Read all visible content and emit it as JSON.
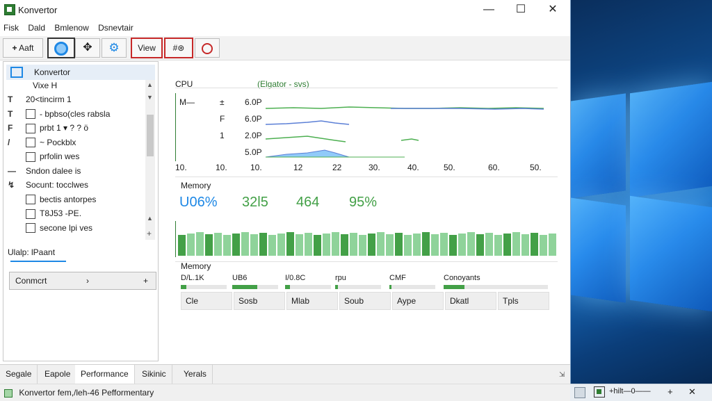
{
  "window": {
    "title": "Konvertor",
    "controls": {
      "minimize": "—",
      "maximize": "☐",
      "close": "✕"
    }
  },
  "menu": [
    "Fisk",
    "Dald",
    "Bmlenow",
    "Dsnevtair"
  ],
  "toolbar": {
    "add_label": "Aaft",
    "view_label": "View",
    "ext_label": "#⊛"
  },
  "tree": {
    "root": "Konvertor",
    "sub": "Vixe H",
    "items": [
      {
        "glyph": "T",
        "box": false,
        "label": "20<tincirm 1"
      },
      {
        "glyph": "T",
        "box": true,
        "label": "- bpbso(cles rabsla"
      },
      {
        "glyph": "F",
        "box": true,
        "label": "prbt 1   ▾   ? ?  ö"
      },
      {
        "glyph": "/",
        "box": true,
        "label": "~ Pockblx"
      },
      {
        "glyph": "",
        "box": true,
        "label": "prfolin wes"
      },
      {
        "glyph": "—",
        "box": false,
        "label": "Sndon dalee is"
      },
      {
        "glyph": "↯",
        "box": false,
        "label": "Socunt: tocclwes"
      },
      {
        "glyph": "",
        "box": true,
        "label": "bectis antorpes"
      },
      {
        "glyph": "",
        "box": true,
        "label": "T8J53 -PE."
      },
      {
        "glyph": "",
        "box": true,
        "label": "secone lpi ves"
      }
    ],
    "footer_label": "Ulalp: lPaant",
    "combo_label": "Conmcrt",
    "combo_arrow": "›",
    "combo_plus": "+"
  },
  "cpu": {
    "title": "CPU",
    "legend": "(Elgator - svs)",
    "rows": [
      {
        "label": "M—",
        "k": "±",
        "v": "6.0P"
      },
      {
        "label": "",
        "k": "F",
        "v": "6.0P"
      },
      {
        "label": "",
        "k": "1",
        "v": "2.0P"
      },
      {
        "label": "",
        "k": "",
        "v": "5.0P"
      }
    ],
    "xticks": [
      "10.",
      "10.",
      "10.",
      "12",
      "22",
      "30.",
      "40.",
      "50.",
      "60.",
      "50."
    ]
  },
  "memory": {
    "title": "Memory",
    "stats": [
      {
        "value": "U06%",
        "color": "#1e88e5"
      },
      {
        "value": "32l5",
        "color": "#43a047"
      },
      {
        "value": "464",
        "color": "#43a047"
      },
      {
        "value": "95%",
        "color": "#43a047"
      }
    ]
  },
  "memory2": {
    "title": "Memory",
    "minis": [
      {
        "label": "D/L.1K",
        "fill": 0.12
      },
      {
        "label": "UB6",
        "fill": 0.55
      },
      {
        "label": "I/0.8C",
        "fill": 0.1
      },
      {
        "label": "rpu",
        "fill": 0.06
      },
      {
        "label": "CMF",
        "fill": 0.05
      },
      {
        "label": "Conoyants",
        "fill": 0.2
      }
    ],
    "chips": [
      "Cle",
      "Sosb",
      "Mlab",
      "Soub",
      "Aype",
      "Dkatl",
      "Tpls"
    ]
  },
  "tabs": [
    "Segale",
    "Eapole",
    "Performance",
    "Sikinic",
    "Yerals"
  ],
  "active_tab": 2,
  "status": {
    "text": "Konvertor  fem,/leh-46 Pefformentary"
  },
  "taskbar": {
    "text": "+hilt—0——",
    "plus": "+",
    "pin": "✕"
  },
  "colors": {
    "accent_green": "#43a047",
    "accent_blue": "#1e88e5",
    "border_red": "#c62828"
  }
}
